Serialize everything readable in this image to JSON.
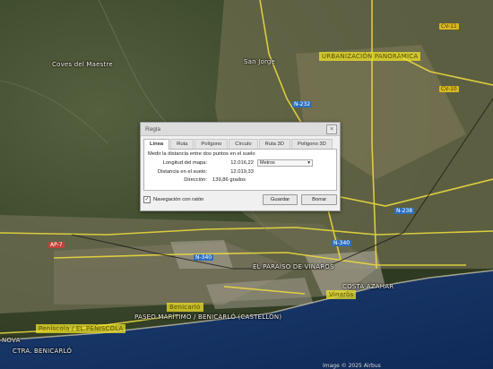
{
  "map": {
    "labels": {
      "coves": "Coves del Maestre",
      "san_jorge": "San Jorge",
      "urbanizacion": "URBANIZACIÓN PANORÀMICA",
      "paraiso": "EL PARAÍSO DE VINARÒS",
      "benicarlo": "Benicarló",
      "vinaros": "Vinaròs",
      "ctra": "PASEO MARÍTIMO / BENICARLÓ (CASTELLÓN)",
      "peniscola": "Peníscola / EL PEÑISCOLA",
      "costa_azahar": "COSTA AZAHAR",
      "nova": "NOVA",
      "ctra2": "CTRA. BENICARLÓ"
    },
    "roads": {
      "n232": "N-232",
      "n238": "N-238",
      "n340": "N-340",
      "ap7": "AP-7",
      "n340b": "N-340",
      "cv11": "CV-11",
      "cv10": "CV-10"
    },
    "credit": "Image © 2025 Airbus"
  },
  "dialog": {
    "title": "Regla",
    "tabs": [
      "Línea",
      "Ruta",
      "Polígono",
      "Círculo",
      "Ruta 3D",
      "Polígono 3D"
    ],
    "description": "Medir la distancia entre dos puntos en el suelo",
    "rows": {
      "map_length": {
        "label": "Longitud del mapa:",
        "value": "12.016,22",
        "unit": "Metros"
      },
      "ground_length": {
        "label": "Distancia en el suelo:",
        "value": "12.019,33"
      },
      "heading": {
        "label": "Dirección:",
        "value": "139,86 grados"
      }
    },
    "navigation_checkbox": {
      "label": "Navegación con ratón",
      "checked": true
    },
    "buttons": {
      "save": "Guardar",
      "clear": "Borrar"
    }
  }
}
